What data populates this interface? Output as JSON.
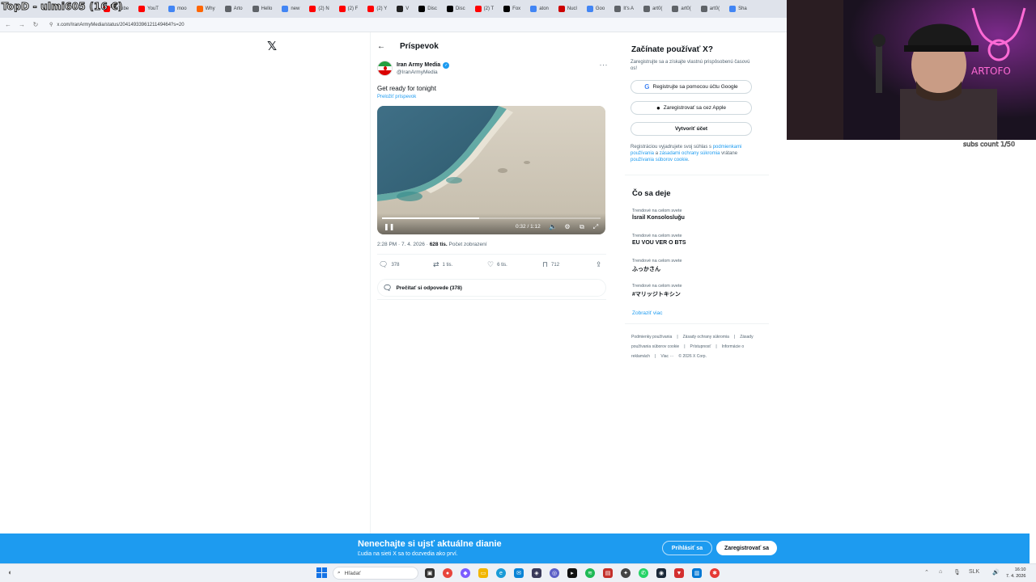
{
  "overlay": {
    "top_left_text": "TopD - ulmi605 (16 €)",
    "cam_caption": "subs count 1/50"
  },
  "browser": {
    "tabs": [
      {
        "label": "ouTube",
        "color": "#ff0000"
      },
      {
        "label": "YouT",
        "color": "#ff0000"
      },
      {
        "label": "moo",
        "color": "#4285f4"
      },
      {
        "label": "Why",
        "color": "#ff6600"
      },
      {
        "label": "Arto",
        "color": "#5f6368"
      },
      {
        "label": "Hello",
        "color": "#5f6368"
      },
      {
        "label": "new",
        "color": "#4285f4"
      },
      {
        "label": "(2) N",
        "color": "#ff0000"
      },
      {
        "label": "(2) F",
        "color": "#ff0000"
      },
      {
        "label": "(2) Y",
        "color": "#ff0000"
      },
      {
        "label": "V",
        "color": "#222222"
      },
      {
        "label": "Disc",
        "color": "#000000"
      },
      {
        "label": "Disc",
        "color": "#000000"
      },
      {
        "label": "(2) T",
        "color": "#ff0000"
      },
      {
        "label": "Fox",
        "color": "#000000"
      },
      {
        "label": "aton",
        "color": "#4285f4"
      },
      {
        "label": "Nucl",
        "color": "#cc0000"
      },
      {
        "label": "Goo",
        "color": "#4285f4"
      },
      {
        "label": "It's A",
        "color": "#5f6368"
      },
      {
        "label": "art0(",
        "color": "#5f6368"
      },
      {
        "label": "art0(",
        "color": "#5f6368"
      },
      {
        "label": "art0(",
        "color": "#5f6368"
      },
      {
        "label": "Sha",
        "color": "#4285f4"
      }
    ],
    "url": "x.com/IranArmyMedia/status/2041493396121149464?s=20"
  },
  "post": {
    "header_title": "Príspevok",
    "author_name": "Iran Army Media",
    "author_handle": "@IranArmyMedia",
    "text": "Get ready for tonight",
    "translate_link": "Preložiť príspevok",
    "video": {
      "current_time": "0:32",
      "duration": "1:12",
      "time_display": "0:32 / 1:12",
      "progress_fraction": 0.444
    },
    "meta_time": "2:28 PM · 7. 4. 2026 · ",
    "meta_views": "628 tis.",
    "meta_views_label": " Počet zobrazení",
    "actions": {
      "replies": "378",
      "reposts": "1 tis.",
      "likes": "6 tis.",
      "bookmarks": "712"
    },
    "read_replies": "Prečítať si odpovede (378)"
  },
  "signup": {
    "title": "Začínate používať X?",
    "description": "Zaregistrujte sa a získajte vlastnú prispôsobenú časovú os!",
    "google_button": "Registrujte sa pomocou účtu Google",
    "apple_button": "Zaregistrovať sa cez Apple",
    "create_button": "Vytvoriť účet",
    "legal_prefix": "Registráciou vyjadrujete svoj súhlas s ",
    "legal_link1": "podmienkami používania",
    "legal_and": " a ",
    "legal_link2": "zásadami ochrany súkromia",
    "legal_incl": " vrátane ",
    "legal_link3": "používania súborov cookie",
    "legal_end": "."
  },
  "trends": {
    "title": "Čo sa deje",
    "items": [
      {
        "category": "Trendové na celom svete",
        "name": "İsrail Konsolosluğu"
      },
      {
        "category": "Trendové na celom svete",
        "name": "EU VOU VER O BTS"
      },
      {
        "category": "Trendové na celom svete",
        "name": "ふっかさん"
      },
      {
        "category": "Trendové na celom svete",
        "name": "#マリッジトキシン"
      }
    ],
    "show_more": "Zobraziť viac"
  },
  "footer": {
    "links": [
      "Podmienky používania",
      "|",
      "Zásady ochrany súkromia",
      "|",
      "Zásady používania súborov cookie",
      "|",
      "Prístupnosť",
      "|",
      "Informácie o reklamách",
      "|",
      "Viac ···",
      "© 2026 X Corp."
    ]
  },
  "banner": {
    "title": "Nenechajte si ujsť aktuálne dianie",
    "subtitle": "Ľudia na sieti X sa to dozvedia ako prví.",
    "login": "Prihlásiť sa",
    "register": "Zaregistrovať sa"
  },
  "taskbar": {
    "search_placeholder": "Hľadať",
    "lang": "SLK",
    "time": "16:10",
    "date": "7. 4. 2026"
  },
  "colors": {
    "accent": "#1d9bf0",
    "text": "#0f1419",
    "muted": "#536471",
    "banner": "#1d9bf0"
  }
}
